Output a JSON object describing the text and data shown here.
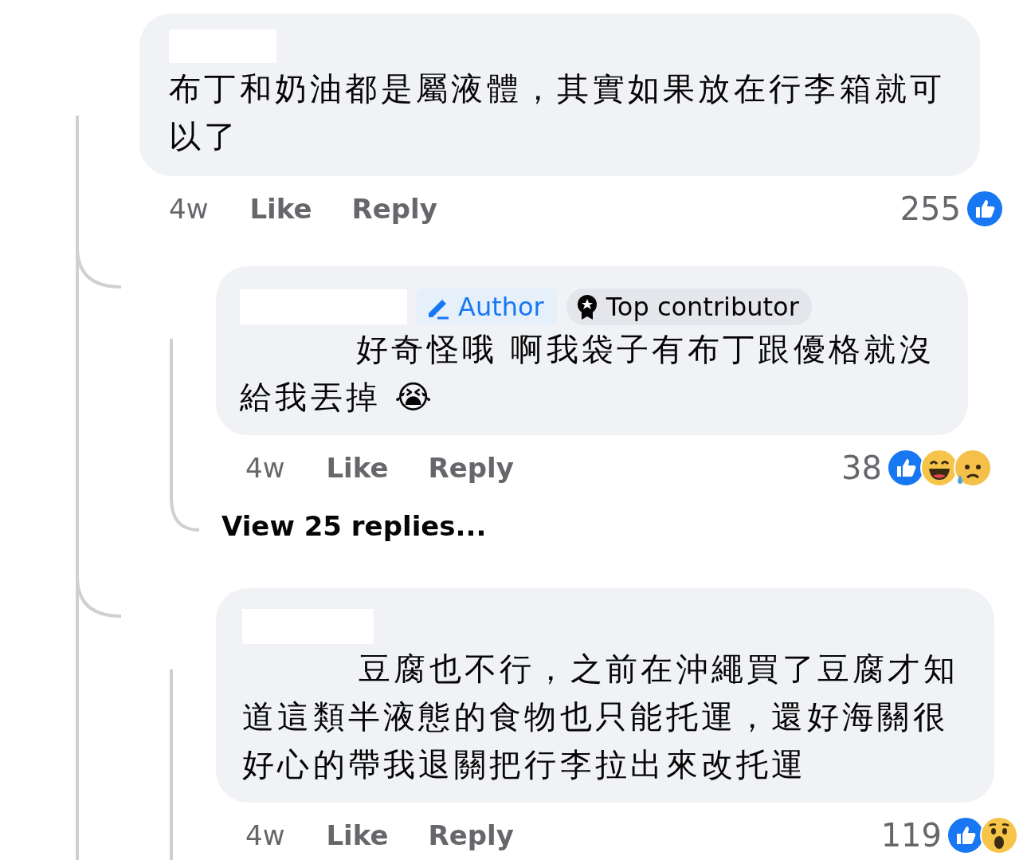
{
  "comments": [
    {
      "text": "布丁和奶油都是屬液體，其實如果放在行李箱就可以了",
      "time": "4w",
      "actions": [
        "Like",
        "Reply"
      ],
      "reaction_count": "255",
      "reactions": [
        {
          "kind": "like"
        }
      ],
      "children": [
        {
          "badges": [
            {
              "kind": "author",
              "label": "Author"
            },
            {
              "kind": "contributor",
              "label": "Top contributor"
            }
          ],
          "text": "好奇怪哦 啊我袋子有布丁跟優格就沒給我丟掉 😭",
          "time": "4w",
          "actions": [
            "Like",
            "Reply"
          ],
          "reaction_count": "38",
          "reactions": [
            {
              "kind": "like"
            },
            {
              "kind": "haha"
            },
            {
              "kind": "sad"
            }
          ],
          "more_replies": "View 25 replies..."
        },
        {
          "text": "豆腐也不行，之前在沖繩買了豆腐才知道這類半液態的食物也只能托運，還好海關很好心的帶我退關把行李拉出來改托運",
          "time": "4w",
          "actions": [
            "Like",
            "Reply"
          ],
          "reaction_count": "119",
          "reactions": [
            {
              "kind": "like"
            },
            {
              "kind": "wow"
            }
          ]
        }
      ]
    }
  ]
}
